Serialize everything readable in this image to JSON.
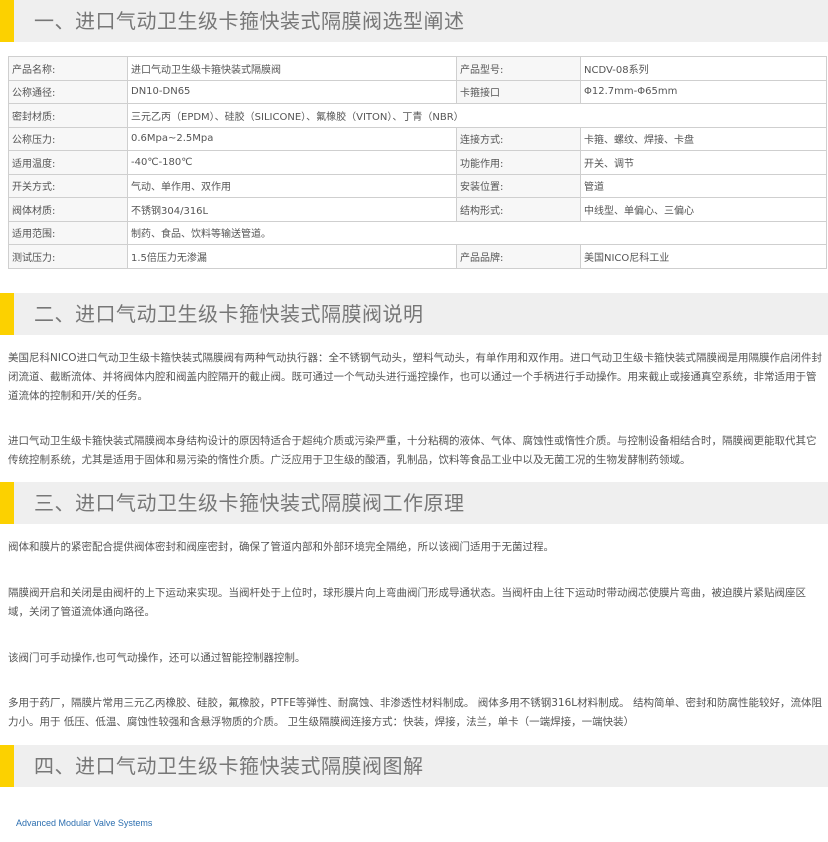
{
  "sections": [
    {
      "title": "一、进口气动卫生级卡箍快装式隔膜阀选型阐述"
    },
    {
      "title": "二、进口气动卫生级卡箍快装式隔膜阀说明"
    },
    {
      "title": "三、进口气动卫生级卡箍快装式隔膜阀工作原理"
    },
    {
      "title": "四、进口气动卫生级卡箍快装式隔膜阀图解"
    }
  ],
  "spec_table": {
    "rows": [
      [
        "产品名称:",
        "进口气动卫生级卡箍快装式隔膜阀",
        "产品型号:",
        "NCDV-08系列"
      ],
      [
        "公称通径:",
        "DN10-DN65",
        "卡箍接口",
        "Φ12.7mm-Φ65mm"
      ],
      [
        "密封材质:",
        "三元乙丙（EPDM）、硅胶（SILICONE）、氟橡胶（VITON）、丁青（NBR）"
      ],
      [
        "公称压力:",
        "0.6Mpa~2.5Mpa",
        "连接方式:",
        "卡箍、螺纹、焊接、卡盘"
      ],
      [
        "适用温度:",
        "-40℃-180℃",
        "功能作用:",
        "开关、调节"
      ],
      [
        "开关方式:",
        "气动、单作用、双作用",
        "安装位置:",
        "管道"
      ],
      [
        "阀体材质:",
        "不锈钢304/316L",
        "结构形式:",
        "中线型、单偏心、三偏心"
      ],
      [
        "适用范围:",
        "制药、食品、饮料等输送管道。"
      ],
      [
        "测试压力:",
        "1.5倍压力无渗漏",
        "产品品牌:",
        "美国NICO尼科工业"
      ]
    ]
  },
  "description": {
    "p1": "美国尼科NICO进口气动卫生级卡箍快装式隔膜阀有两种气动执行器：全不锈钢气动头，塑料气动头，有单作用和双作用。进口气动卫生级卡箍快装式隔膜阀是用隔膜作启闭件封闭流道、截断流体、并将阀体内腔和阀盖内腔隔开的截止阀。既可通过一个气动头进行遥控操作，也可以通过一个手柄进行手动操作。用来截止或接通真空系统，非常适用于管道流体的控制和开/关的任务。",
    "p2": "进口气动卫生级卡箍快装式隔膜阀本身结构设计的原因特适合于超纯介质或污染严重，十分粘稠的液体、气体、腐蚀性或惰性介质。与控制设备相结合时，隔膜阀更能取代其它传统控制系统，尤其是适用于固体和易污染的惰性介质。广泛应用于卫生级的酸酒，乳制品，饮料等食品工业中以及无菌工况的生物发酵制药领域。"
  },
  "principle": {
    "p1": "阀体和膜片的紧密配合提供阀体密封和阀座密封，确保了管道内部和外部环境完全隔绝，所以该阀门适用于无菌过程。",
    "p2": "隔膜阀开启和关闭是由阀杆的上下运动来实现。当阀杆处于上位时，球形膜片向上弯曲阀门形成导通状态。当阀杆由上往下运动时带动阀芯使膜片弯曲，被迫膜片紧贴阀座区域，关闭了管道流体通向路径。",
    "p3": "该阀门可手动操作,也可气动操作，还可以通过智能控制器控制。",
    "p4": "多用于药厂，隔膜片常用三元乙丙橡胶、硅胶，氟橡胶，PTFE等弹性、耐腐蚀、非渗透性材料制成。 阀体多用不锈钢316L材料制成。 结构简单、密封和防腐性能较好，流体阻力小。用于 低压、低温、腐蚀性较强和含悬浮物质的介质。 卫生级隔膜阀连接方式：快装，焊接，法兰，单卡（一端焊接，一端快装）"
  },
  "diagram_caption": "Advanced Modular Valve Systems",
  "colors": {
    "accent": "#fcd100",
    "header_bg": "#efefef",
    "caption_text": "#2d6fb0"
  }
}
